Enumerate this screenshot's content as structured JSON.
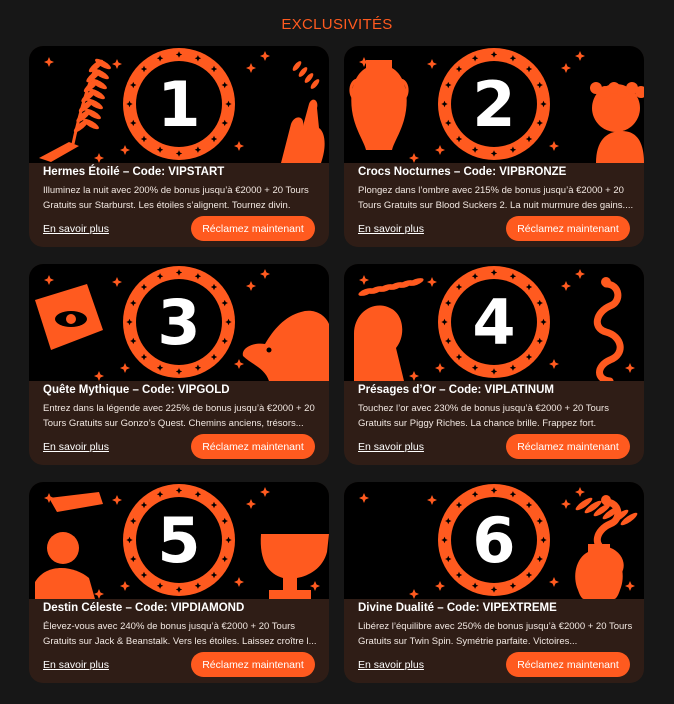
{
  "page": {
    "heading": "EXCLUSIVITÉS"
  },
  "colors": {
    "accent": "#ff5a1f",
    "card_bg": "#2f1d16",
    "page_bg": "#171717"
  },
  "cards": [
    {
      "numeral": "1",
      "title": "Hermes Étoilé – Code: VIPSTART",
      "description": "Illuminez la nuit avec 200% de bonus jusqu’à €2000 + 20 Tours Gratuits sur Starburst. Les étoiles s’alignent. Tournez divin.",
      "learn_more": "En savoir plus",
      "claim": "Réclamez maintenant",
      "left_art": "palm-leaf-hand-icon",
      "right_art": "hand-gesture-icon"
    },
    {
      "numeral": "2",
      "title": "Crocs Nocturnes – Code: VIPBRONZE",
      "description": "Plongez dans l’ombre avec 215% de bonus jusqu’à €2000 + 20 Tours Gratuits sur Blood Suckers 2. La nuit murmure des gains....",
      "learn_more": "En savoir plus",
      "claim": "Réclamez maintenant",
      "left_art": "amphora-icon",
      "right_art": "greek-bust-icon"
    },
    {
      "numeral": "3",
      "title": "Quête Mythique – Code: VIPGOLD",
      "description": "Entrez dans la légende avec 225% de bonus jusqu’à €2000 + 20 Tours Gratuits sur Gonzo’s Quest. Chemins anciens, trésors...",
      "learn_more": "En savoir plus",
      "claim": "Réclamez maintenant",
      "left_art": "stone-eye-relief-icon",
      "right_art": "horse-head-icon"
    },
    {
      "numeral": "4",
      "title": "Présages d’Or – Code: VIPLATINUM",
      "description": "Touchez l’or avec 230% de bonus jusqu’à €2000 + 20 Tours Gratuits sur Piggy Riches. La chance brille. Frappez fort.",
      "learn_more": "En savoir plus",
      "claim": "Réclamez maintenant",
      "left_art": "laurel-bust-icon",
      "right_art": "serpent-icon"
    },
    {
      "numeral": "5",
      "title": "Destin Céleste – Code: VIPDIAMOND",
      "description": "Élevez-vous avec 240% de bonus jusqu’à €2000 + 20 Tours Gratuits sur Jack & Beanstalk. Vers les étoiles. Laissez croître l...",
      "learn_more": "En savoir plus",
      "claim": "Réclamez maintenant",
      "left_art": "hands-orb-icon",
      "right_art": "chalice-icon"
    },
    {
      "numeral": "6",
      "title": "Divine Dualité – Code: VIPEXTREME",
      "description": "Libérez l’équilibre avec 250% de bonus jusqu’à €2000 + 20 Tours Gratuits sur Twin Spin. Symétrie parfaite. Victoires...",
      "learn_more": "En savoir plus",
      "claim": "Réclamez maintenant",
      "left_art": "serpent-icon",
      "right_art": "vase-leaf-icon"
    }
  ]
}
